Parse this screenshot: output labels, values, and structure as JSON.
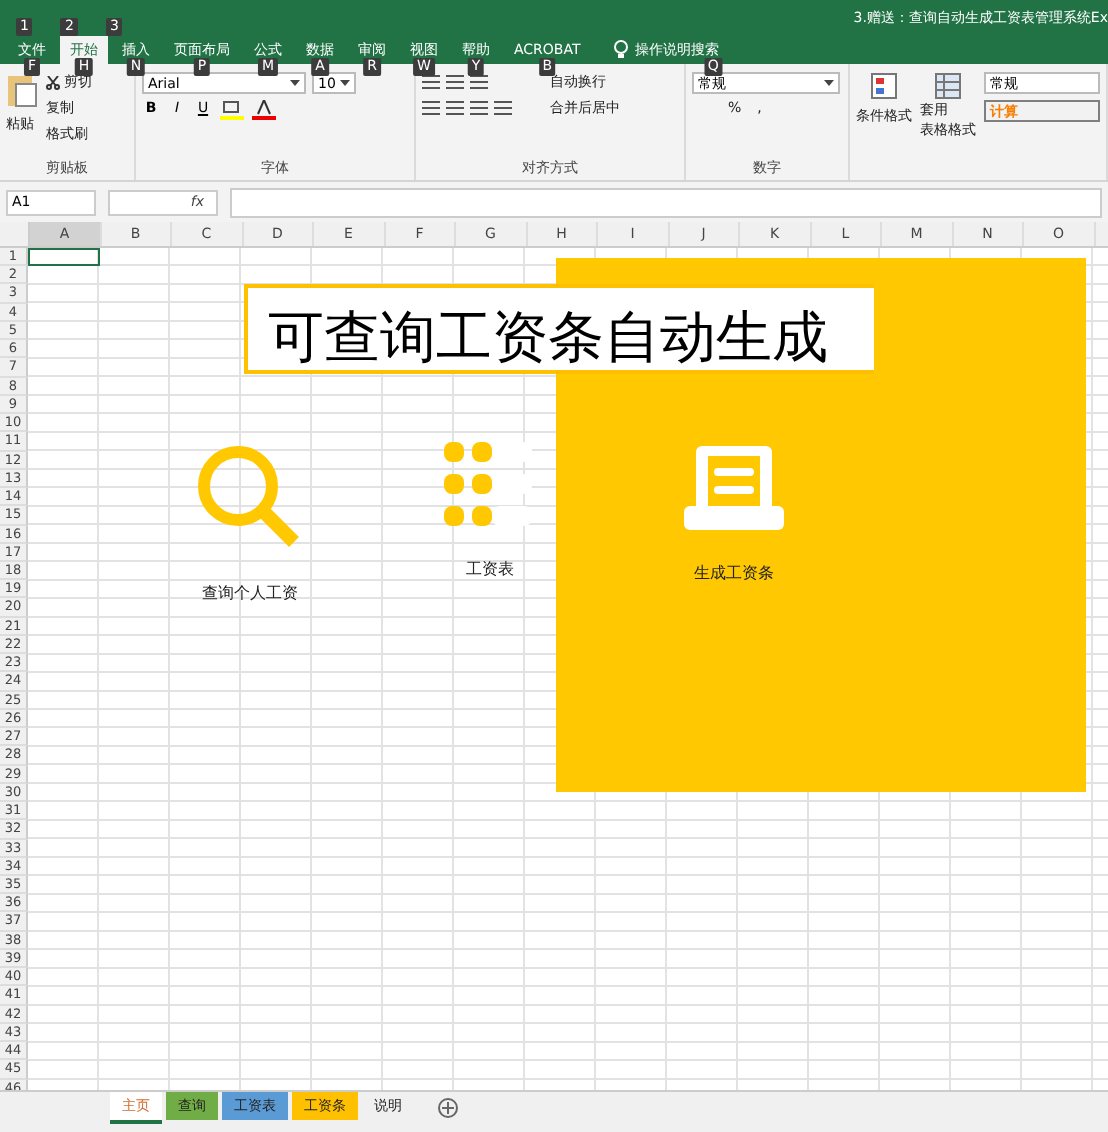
{
  "window": {
    "title": "3.赠送：查询自动生成工资表管理系统Ex",
    "qat_keytips": [
      "1",
      "2",
      "3"
    ]
  },
  "ribbon_tabs": [
    {
      "label": "文件",
      "keytip": "F",
      "selected": false
    },
    {
      "label": "开始",
      "keytip": "H",
      "selected": true
    },
    {
      "label": "插入",
      "keytip": "N",
      "selected": false
    },
    {
      "label": "页面布局",
      "keytip": "P",
      "selected": false
    },
    {
      "label": "公式",
      "keytip": "M",
      "selected": false
    },
    {
      "label": "数据",
      "keytip": "A",
      "selected": false
    },
    {
      "label": "审阅",
      "keytip": "R",
      "selected": false
    },
    {
      "label": "视图",
      "keytip": "W",
      "selected": false
    },
    {
      "label": "帮助",
      "keytip": "Y",
      "selected": false
    },
    {
      "label": "ACROBAT",
      "keytip": "B",
      "selected": false
    }
  ],
  "tell_me": {
    "label": "操作说明搜索",
    "keytip": "Q"
  },
  "ribbon": {
    "clipboard": {
      "paste": "粘贴",
      "cut": "剪切",
      "copy": "复制",
      "format_painter": "格式刷",
      "label": "剪贴板"
    },
    "font": {
      "name": "Arial",
      "size": "10",
      "bold": "B",
      "italic": "I",
      "underline": "U",
      "label": "字体"
    },
    "alignment": {
      "wrap": "自动换行",
      "merge": "合并后居中",
      "label": "对齐方式"
    },
    "number": {
      "format": "常规",
      "percent": "%",
      "comma": ",",
      "label": "数字"
    },
    "styles": {
      "conditional": "条件格式",
      "table_line1": "套用",
      "table_line2": "表格格式",
      "normal": "常规",
      "calc": "计算"
    }
  },
  "formula_bar": {
    "name_box": "A1",
    "fx": "fx"
  },
  "columns": [
    "A",
    "B",
    "C",
    "D",
    "E",
    "F",
    "G",
    "H",
    "I",
    "J",
    "K",
    "L",
    "M",
    "N",
    "O"
  ],
  "rows": [
    "1",
    "2",
    "3",
    "4",
    "5",
    "6",
    "7",
    "8",
    "9",
    "10",
    "11",
    "12",
    "13",
    "14",
    "15",
    "16",
    "17",
    "18",
    "19",
    "20",
    "21",
    "22",
    "23",
    "24",
    "25",
    "26",
    "27",
    "28",
    "29",
    "30",
    "31",
    "32",
    "33",
    "34",
    "35",
    "36",
    "37",
    "38",
    "39",
    "40",
    "41",
    "42",
    "43",
    "44",
    "45",
    "46"
  ],
  "dashboard": {
    "title": "可查询工资条自动生成",
    "buttons": [
      {
        "kind": "search",
        "label": "查询个人工资"
      },
      {
        "kind": "list",
        "label": "工资表"
      },
      {
        "kind": "document",
        "label": "生成工资条"
      }
    ]
  },
  "sheet_tabs": [
    {
      "label": "主页",
      "selected": true
    },
    {
      "label": "查询",
      "color": "#70ad47",
      "selected": false
    },
    {
      "label": "工资表",
      "color": "#5b9bd5",
      "selected": false
    },
    {
      "label": "工资条",
      "color": "#ffc000",
      "selected": false
    },
    {
      "label": "说明",
      "selected": false
    }
  ]
}
